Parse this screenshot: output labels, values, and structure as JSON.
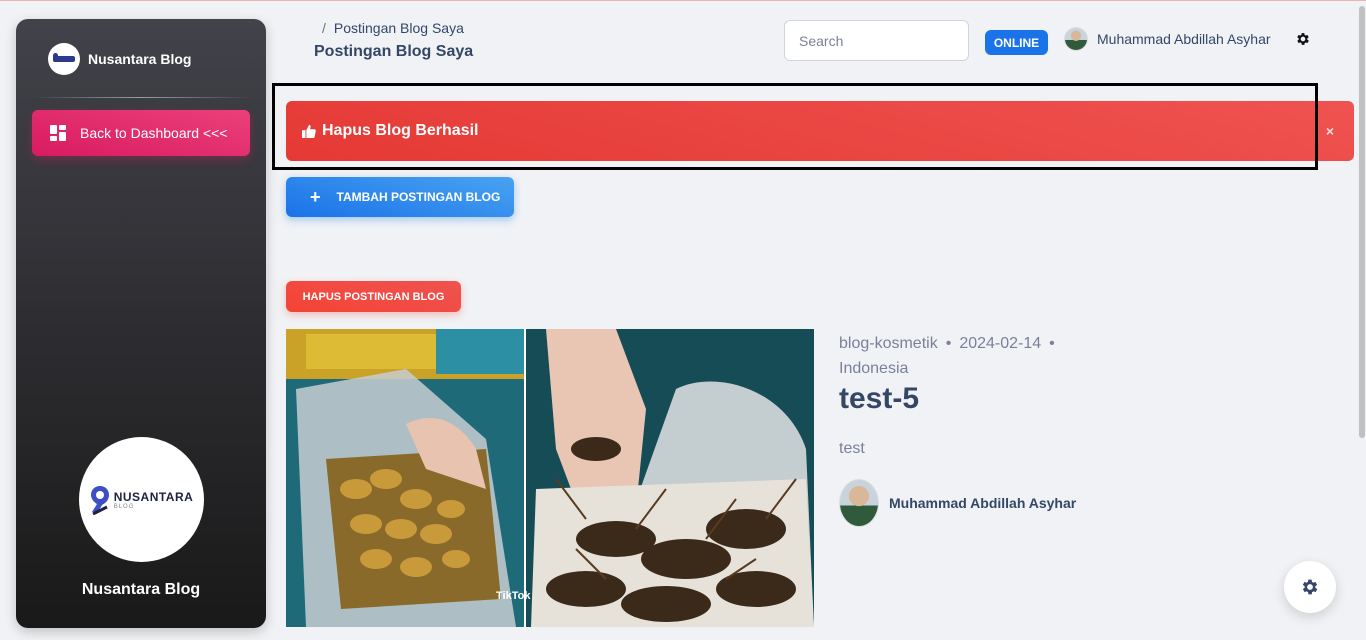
{
  "sidebar": {
    "brand_name": "Nusantara Blog",
    "back_button_label": "Back to Dashboard <<<",
    "logo_text_main": "NUSANTARA",
    "logo_text_sub": "BLOG",
    "footer_name": "Nusantara Blog"
  },
  "header": {
    "breadcrumb_separator": "/",
    "breadcrumb_current": "Postingan Blog Saya",
    "page_title": "Postingan Blog Saya",
    "search_placeholder": "Search",
    "status_badge": "ONLINE",
    "user_name": "Muhammad Abdillah Asyhar"
  },
  "alert": {
    "message": "Hapus Blog Berhasil",
    "close": "×",
    "icon": "thumbs-up-icon"
  },
  "actions": {
    "add_plus": "+",
    "add_label": "TAMBAH POSTINGAN BLOG",
    "delete_label": "HAPUS POSTINGAN BLOG"
  },
  "post": {
    "category": "blog-kosmetik",
    "date": "2024-02-14",
    "location": "Indonesia",
    "title": "test-5",
    "excerpt": "test",
    "author": "Muhammad Abdillah Asyhar",
    "image_overlay_text": "TikTok"
  },
  "colors": {
    "primary": "#1a73e8",
    "danger": "#f44335",
    "pink": "#e91e63",
    "text": "#344767"
  }
}
